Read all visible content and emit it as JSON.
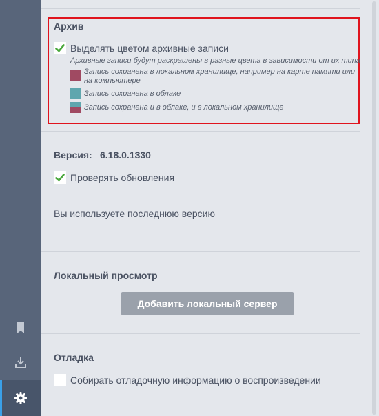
{
  "archive": {
    "title": "Архив",
    "highlight_label": "Выделять цветом архивные записи",
    "highlight_checked": true,
    "description": "Архивные записи будут раскрашены в разные цвета в зависимости от их типа",
    "legend": [
      {
        "text": "Запись сохранена в локальном хранилище, например на карте памяти или на компьютере",
        "color": "#a04a62"
      },
      {
        "text": "Запись сохранена в облаке",
        "color": "#5fa6ae"
      },
      {
        "text": "Запись сохранена и в облаке, и в локальном хранилище",
        "colors": [
          "#5fa6ae",
          "#a04a62"
        ]
      }
    ]
  },
  "version": {
    "label": "Версия:",
    "value": "6.18.0.1330",
    "check_updates_label": "Проверять обновления",
    "check_updates_checked": true,
    "status": "Вы используете последнюю версию"
  },
  "local_view": {
    "title": "Локальный просмотр",
    "add_server_button": "Добавить локальный сервер"
  },
  "debug": {
    "title": "Отладка",
    "collect_label": "Собирать отладочную информацию о воспроизведении",
    "collect_checked": false
  },
  "sidebar": {
    "items": [
      {
        "icon": "bookmark-icon"
      },
      {
        "icon": "download-icon"
      },
      {
        "icon": "gear-icon",
        "active": true
      }
    ]
  },
  "colors": {
    "check": "#4aa83c",
    "highlight_border": "#e0141e",
    "accent": "#3aa0e8"
  }
}
